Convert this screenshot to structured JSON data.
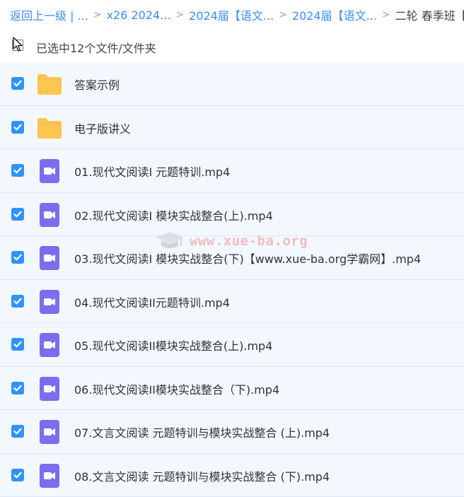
{
  "breadcrumb": {
    "items": [
      {
        "label": "返回上一级 | ..."
      },
      {
        "label": "x26 2024..."
      },
      {
        "label": "2024届【语文..."
      },
      {
        "label": "2024届【语文..."
      },
      {
        "label": "二轮 春季班【w..."
      }
    ],
    "separator": ">"
  },
  "selection": {
    "text": "已选中12个文件/文件夹"
  },
  "files": [
    {
      "name": "答案示例",
      "type": "folder",
      "checked": true
    },
    {
      "name": "电子版讲义",
      "type": "folder",
      "checked": true
    },
    {
      "name": "01.现代文阅读I 元题特训.mp4",
      "type": "video",
      "checked": true
    },
    {
      "name": "02.现代文阅读I 模块实战整合(上).mp4",
      "type": "video",
      "checked": true
    },
    {
      "name": "03.现代文阅读I 模块实战整合(下)【www.xue-ba.org学霸网】.mp4",
      "type": "video",
      "checked": true
    },
    {
      "name": "04.现代文阅读II元题特训.mp4",
      "type": "video",
      "checked": true
    },
    {
      "name": "05.现代文阅读II模块实战整合(上).mp4",
      "type": "video",
      "checked": true
    },
    {
      "name": "06.现代文阅读II模块实战整合（下).mp4",
      "type": "video",
      "checked": true
    },
    {
      "name": "07.文言文阅读 元题特训与模块实战整合 (上).mp4",
      "type": "video",
      "checked": true
    },
    {
      "name": "08.文言文阅读 元题特训与模块实战整合 (下).mp4",
      "type": "video",
      "checked": true
    }
  ],
  "watermark": {
    "text": "www.xue-ba.org"
  },
  "colors": {
    "accent": "#2e93ff",
    "link": "#3b8cff",
    "row_bg": "#f3f8fe",
    "folder": "#fcc64f",
    "video": "#7b6cf0"
  }
}
